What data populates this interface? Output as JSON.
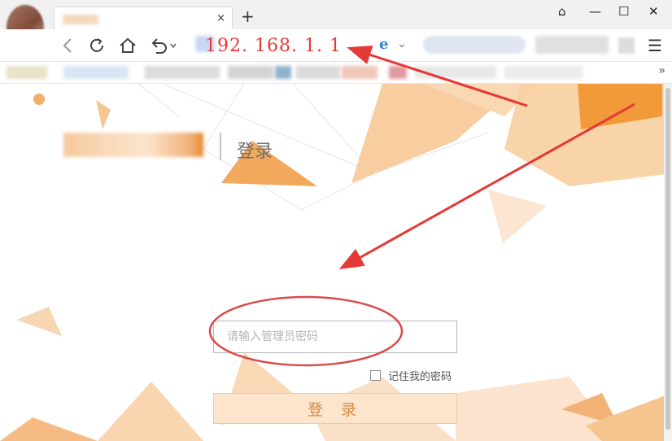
{
  "browser": {
    "new_tab_symbol": "+",
    "tab_close_symbol": "×",
    "address_url": "192. 168. 1. 1",
    "window_buttons": [
      "⌂",
      "—",
      "☐",
      "✕"
    ],
    "bookmarks_more": "»"
  },
  "page": {
    "title": "登录",
    "password_placeholder": "请输入管理员密码",
    "remember_label": "记住我的密码",
    "login_button": "登 录"
  },
  "colors": {
    "annotation_red": "#e53935",
    "accent_orange": "#f29a3a",
    "button_bg": "#fde4cc",
    "button_text": "#d78a3e"
  },
  "icons": [
    "back-icon",
    "refresh-icon",
    "home-icon",
    "undo-icon",
    "ie-icon",
    "menu-icon",
    "shirt-icon",
    "checkbox"
  ]
}
